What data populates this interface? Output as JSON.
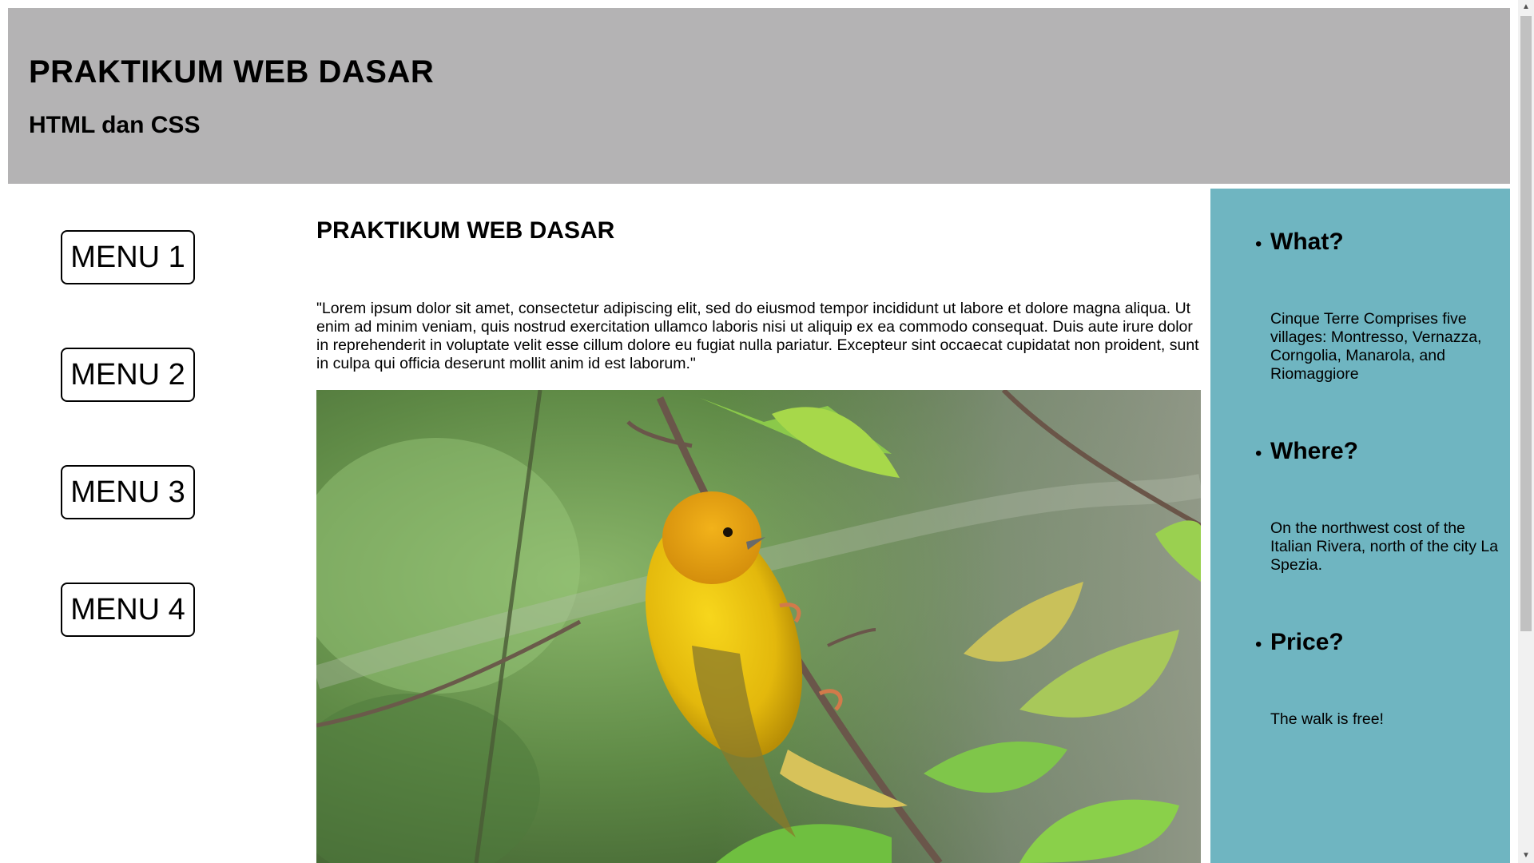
{
  "header": {
    "title": "PRAKTIKUM WEB DASAR",
    "subtitle": "HTML dan CSS"
  },
  "menu": {
    "items": [
      {
        "label": "MENU 1"
      },
      {
        "label": "MENU 2"
      },
      {
        "label": "MENU 3"
      },
      {
        "label": "MENU 4"
      }
    ]
  },
  "main": {
    "title": "PRAKTIKUM WEB DASAR",
    "paragraph": "\"Lorem ipsum dolor sit amet, consectetur adipiscing elit, sed do eiusmod tempor incididunt ut labore et dolore magna aliqua. Ut enim ad minim veniam, quis nostrud exercitation ullamco laboris nisi ut aliquip ex ea commodo consequat. Duis aute irure dolor in reprehenderit in voluptate velit esse cillum dolore eu fugiat nulla pariatur. Excepteur sint occaecat cupidatat non proident, sunt in culpa qui officia deserunt mollit anim id est laborum.\""
  },
  "aside": {
    "items": [
      {
        "heading": "What?",
        "text": "Cinque Terre Comprises five villages: Montresso, Vernazza, Corngolia, Manarola, and Riomaggiore"
      },
      {
        "heading": "Where?",
        "text": "On the northwest cost of the Italian Rivera, north of the city La Spezia."
      },
      {
        "heading": "Price?",
        "text": "The walk is free!"
      }
    ]
  },
  "colors": {
    "header_bg": "#b4b3b4",
    "aside_bg": "#6fb5c1"
  },
  "icons": {
    "scroll_up": "scroll-up-arrow-icon",
    "scroll_down": "scroll-down-arrow-icon"
  }
}
